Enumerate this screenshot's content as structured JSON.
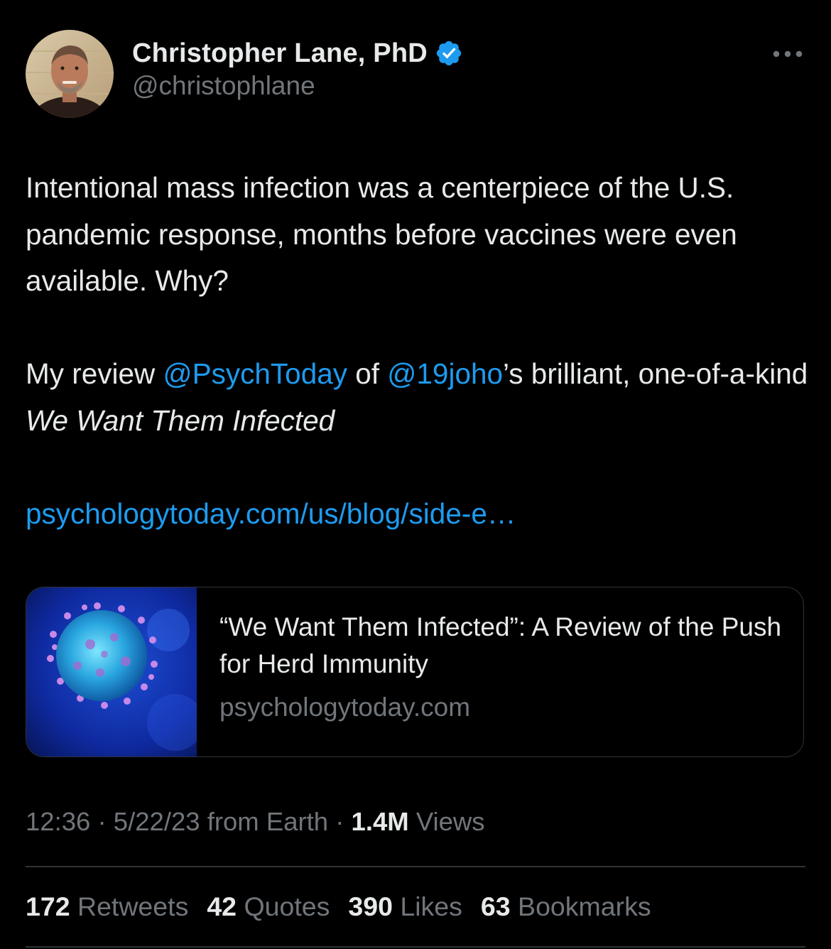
{
  "author": {
    "display_name": "Christopher Lane, PhD",
    "handle": "@christophlane",
    "verified": true,
    "avatar_icon": "profile-photo",
    "badge_color": "#1d9bf0"
  },
  "more_icon": "ellipsis-icon",
  "tweet": {
    "paragraph1": "Intentional mass infection was a centerpiece of the U.S. pandemic response, months before vaccines were even available. Why?",
    "p2_part1": "My review ",
    "mention1": "@PsychToday",
    "p2_part2": " of ",
    "mention2": "@19joho",
    "p2_part3": "’s brilliant, one-of-a-kind ",
    "book_title": "We Want Them Infected",
    "link": "psychologytoday.com/us/blog/side-e…"
  },
  "card": {
    "image_icon": "virus-image",
    "title": "“We Want Them Infected”: A Review of the Push for Herd Immunity",
    "domain": "psychologytoday.com"
  },
  "meta": {
    "time": "12:36",
    "sep1": " · ",
    "date": "5/22/23",
    "source": " from Earth",
    "sep2": " · ",
    "views_count": "1.4M",
    "views_label": " Views"
  },
  "stats": [
    {
      "count": "172",
      "label": " Retweets"
    },
    {
      "count": "42",
      "label": " Quotes"
    },
    {
      "count": "390",
      "label": " Likes"
    },
    {
      "count": "63",
      "label": " Bookmarks"
    }
  ],
  "colors": {
    "background": "#000000",
    "text": "#e7e9ea",
    "secondary": "#71767b",
    "accent": "#1d9bf0",
    "divider": "#2f3336"
  }
}
